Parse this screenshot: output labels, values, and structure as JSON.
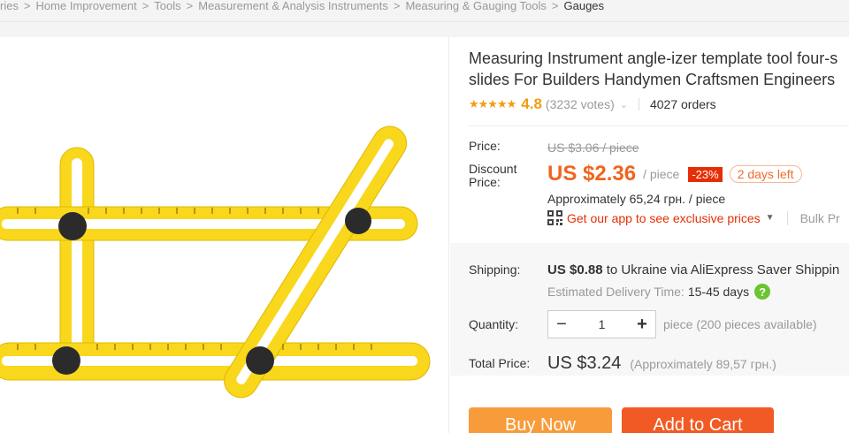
{
  "breadcrumb": {
    "items": [
      "ries",
      "Home Improvement",
      "Tools",
      "Measurement & Analysis Instruments",
      "Measuring & Gauging Tools"
    ],
    "current": "Gauges",
    "separator": ">"
  },
  "product": {
    "title_line1": "Measuring Instrument angle-izer template tool four-s",
    "title_line2": "slides For Builders Handymen Craftsmen Engineers",
    "stars": "★★★★★",
    "rating": "4.8",
    "votes": "(3232 votes)",
    "orders": "4027 orders"
  },
  "pricing": {
    "price_label": "Price:",
    "original_price": "US $3.06 / piece",
    "discount_label_line1": "Discount",
    "discount_label_line2": "Price:",
    "discount_price": "US $2.36",
    "unit": "/ piece",
    "discount_pct": "-23%",
    "days_left": "2 days left",
    "approx": "Approximately 65,24 грн. / piece",
    "app_offer": "Get our app to see exclusive prices",
    "bulk": "Bulk Pr"
  },
  "shipping": {
    "label": "Shipping:",
    "cost": "US $0.88",
    "to": "to Ukraine via AliExpress Saver Shippin",
    "est_label": "Estimated Delivery Time:",
    "est_days": "15-45 days",
    "help_icon": "?"
  },
  "quantity": {
    "label": "Quantity:",
    "minus": "−",
    "value": "1",
    "plus": "+",
    "note": "piece (200 pieces available)"
  },
  "total": {
    "label": "Total Price:",
    "value": "US $3.24",
    "approx": "(Approximately 89,57 грн.)"
  },
  "actions": {
    "buy_now": "Buy Now",
    "add_to_cart": "Add to Cart"
  },
  "colors": {
    "accent_orange": "#f0651e",
    "discount_red": "#e62e04",
    "buy_button": "#f89b3a",
    "cart_button": "#f15a24",
    "ruler_yellow": "#f9d71c"
  }
}
